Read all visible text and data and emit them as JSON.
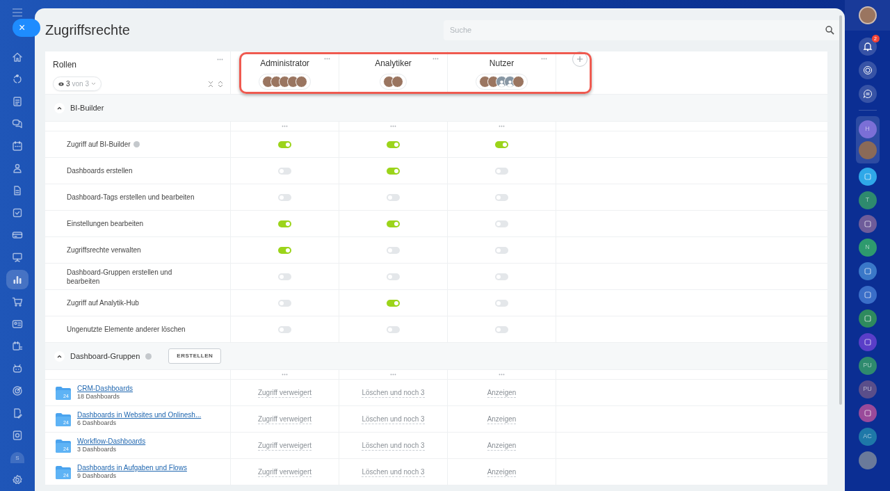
{
  "left_nav": {
    "close_label": "×",
    "items": [
      {
        "kind": "icon",
        "selected": false
      },
      {
        "kind": "icon",
        "selected": false
      },
      {
        "kind": "icon",
        "selected": false
      },
      {
        "kind": "icon",
        "selected": false
      },
      {
        "kind": "icon",
        "selected": false
      },
      {
        "kind": "icon",
        "selected": false
      },
      {
        "kind": "icon",
        "selected": false
      },
      {
        "kind": "icon",
        "selected": false
      },
      {
        "kind": "icon",
        "selected": false
      },
      {
        "kind": "icon",
        "selected": false
      },
      {
        "kind": "icon",
        "selected": true
      },
      {
        "kind": "icon",
        "selected": false
      },
      {
        "kind": "icon",
        "selected": false
      },
      {
        "kind": "icon",
        "selected": false
      },
      {
        "kind": "icon",
        "selected": false
      },
      {
        "kind": "icon",
        "selected": false
      },
      {
        "kind": "icon",
        "selected": false
      },
      {
        "kind": "icon",
        "selected": false
      },
      {
        "kind": "letter",
        "text": "S",
        "selected": false
      }
    ]
  },
  "title": "Zugriffsrechte",
  "search": {
    "placeholder": "Suche"
  },
  "roles_header": {
    "label": "Rollen",
    "filter_count": "3",
    "filter_total": "von 3"
  },
  "roles": [
    {
      "name": "Administrator",
      "avatars": [
        {
          "kind": "photo"
        },
        {
          "kind": "photo"
        },
        {
          "kind": "photo"
        },
        {
          "kind": "photo"
        },
        {
          "kind": "photo"
        }
      ]
    },
    {
      "name": "Analytiker",
      "avatars": [
        {
          "kind": "photo"
        },
        {
          "kind": "photo"
        }
      ]
    },
    {
      "name": "Nutzer",
      "avatars": [
        {
          "kind": "photo"
        },
        {
          "kind": "photo"
        },
        {
          "kind": "silhouette"
        },
        {
          "kind": "silhouette"
        },
        {
          "kind": "photo"
        }
      ]
    }
  ],
  "sections": [
    {
      "title": "BI-Builder",
      "expanded": true,
      "rows": [
        {
          "kind": "toggle",
          "label": "Zugriff auf BI-Builder",
          "help": true,
          "values": [
            true,
            true,
            true
          ]
        },
        {
          "kind": "toggle",
          "label": "Dashboards erstellen",
          "help": false,
          "values": [
            false,
            true,
            false
          ]
        },
        {
          "kind": "toggle",
          "label": "Dashboard-Tags erstellen und bearbeiten",
          "help": false,
          "values": [
            false,
            false,
            false
          ]
        },
        {
          "kind": "toggle",
          "label": "Einstellungen bearbeiten",
          "help": false,
          "values": [
            true,
            true,
            false
          ]
        },
        {
          "kind": "toggle",
          "label": "Zugriffsrechte verwalten",
          "help": false,
          "values": [
            true,
            false,
            false
          ]
        },
        {
          "kind": "toggle",
          "label": "Dashboard-Gruppen erstellen und bearbeiten",
          "help": false,
          "values": [
            false,
            false,
            false
          ]
        },
        {
          "kind": "toggle",
          "label": "Zugriff auf Analytik-Hub",
          "help": false,
          "values": [
            false,
            true,
            false
          ]
        },
        {
          "kind": "toggle",
          "label": "Ungenutzte Elemente anderer löschen",
          "help": false,
          "values": [
            false,
            false,
            false
          ]
        }
      ]
    },
    {
      "title": "Dashboard-Gruppen",
      "expanded": true,
      "help": true,
      "button": "ERSTELLEN",
      "rows": [
        {
          "kind": "group",
          "name": "CRM-Dashboards",
          "count": "18 Dashboards",
          "folder_label": "24",
          "cells": [
            "Zugriff verweigert",
            "Löschen und noch 3",
            "Anzeigen"
          ]
        },
        {
          "kind": "group",
          "name": "Dashboards in Websites und Onlinesh...",
          "count": "6 Dashboards",
          "folder_label": "24",
          "cells": [
            "Zugriff verweigert",
            "Löschen und noch 3",
            "Anzeigen"
          ]
        },
        {
          "kind": "group",
          "name": "Workflow-Dashboards",
          "count": "3 Dashboards",
          "folder_label": "24",
          "cells": [
            "Zugriff verweigert",
            "Löschen und noch 3",
            "Anzeigen"
          ]
        },
        {
          "kind": "group",
          "name": "Dashboards in Aufgaben und Flows",
          "count": "9 Dashboards",
          "folder_label": "24",
          "cells": [
            "Zugriff verweigert",
            "Löschen und noch 3",
            "Anzeigen"
          ]
        }
      ]
    }
  ],
  "right_bar": {
    "notifications": "2",
    "chats": [
      {
        "kind": "letter",
        "text": "H",
        "color": "#7b6fd6",
        "pinned": true
      },
      {
        "kind": "photo",
        "color": "#8a6a58",
        "pinned": true
      },
      {
        "kind": "icon",
        "color": "#2fa8e8",
        "pinned": false
      },
      {
        "kind": "letter",
        "text": "T",
        "color": "#2e8a6e",
        "pinned": false
      },
      {
        "kind": "icon",
        "color": "#6e5c9a",
        "pinned": false
      },
      {
        "kind": "letter",
        "text": "N",
        "color": "#2e9a6e",
        "pinned": false
      },
      {
        "kind": "icon",
        "color": "#3a78c8",
        "pinned": false
      },
      {
        "kind": "icon",
        "color": "#3a6ec8",
        "pinned": false
      },
      {
        "kind": "icon",
        "color": "#2e8a5e",
        "pinned": false
      },
      {
        "kind": "icon",
        "color": "#5a3ec8",
        "pinned": false
      },
      {
        "kind": "letter",
        "text": "PU",
        "color": "#2e8a6e",
        "pinned": false
      },
      {
        "kind": "letter",
        "text": "PU",
        "color": "#5a4e8a",
        "pinned": false
      },
      {
        "kind": "icon",
        "color": "#9a4a9a",
        "pinned": false
      },
      {
        "kind": "letter",
        "text": "AC",
        "color": "#1e78a8",
        "pinned": false
      },
      {
        "kind": "photo",
        "color": "#6a7a9a",
        "pinned": false
      }
    ]
  }
}
